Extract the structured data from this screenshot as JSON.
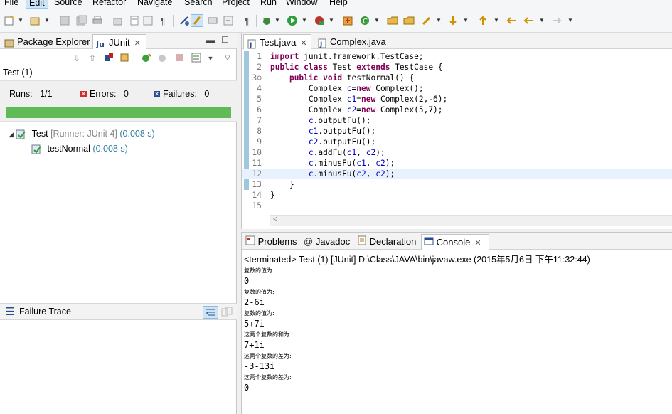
{
  "menu": [
    "File",
    "Edit",
    "Source",
    "Refactor",
    "Navigate",
    "Search",
    "Project",
    "Run",
    "Window",
    "Help"
  ],
  "left_tabs": {
    "package_explorer": "Package Explorer",
    "junit": "JUnit"
  },
  "junit": {
    "test_count_label": "Test (1)",
    "runs_label": "Runs:",
    "runs_value": "1/1",
    "errors_label": "Errors:",
    "errors_value": "0",
    "failures_label": "Failures:",
    "failures_value": "0",
    "progress_fraction": 1.0,
    "tree": {
      "root_name": "Test",
      "root_runner": "[Runner: JUnit 4]",
      "root_time": "(0.008 s)",
      "child_name": "testNormal",
      "child_time": "(0.008 s)"
    },
    "failure_trace_label": "Failure Trace"
  },
  "editor_tabs": [
    "Test.java",
    "Complex.java"
  ],
  "code_lines": [
    {
      "n": "1",
      "t": "import junit.framework.TestCase;"
    },
    {
      "n": "2",
      "t": "public class Test extends TestCase {"
    },
    {
      "n": "3⊖",
      "t": "    public void testNormal() {"
    },
    {
      "n": "4",
      "t": "        Complex c=new Complex();"
    },
    {
      "n": "5",
      "t": "        Complex c1=new Complex(2,-6);"
    },
    {
      "n": "6",
      "t": "        Complex c2=new Complex(5,7);"
    },
    {
      "n": "7",
      "t": "        c.outputFu();"
    },
    {
      "n": "8",
      "t": "        c1.outputFu();"
    },
    {
      "n": "9",
      "t": "        c2.outputFu();"
    },
    {
      "n": "10",
      "t": "        c.addFu(c1, c2);"
    },
    {
      "n": "11",
      "t": "        c.minusFu(c1, c2);"
    },
    {
      "n": "12",
      "t": "        c.minusFu(c2, c2);"
    },
    {
      "n": "13",
      "t": "    }"
    },
    {
      "n": "14",
      "t": "}"
    },
    {
      "n": "15",
      "t": ""
    }
  ],
  "bottom_tabs": [
    "Problems",
    "Javadoc",
    "Declaration",
    "Console"
  ],
  "console": {
    "title": "<terminated> Test (1) [JUnit] D:\\Class\\JAVA\\bin\\javaw.exe (2015年5月6日 下午11:32:44)",
    "lines": [
      {
        "t": "复数的值为:",
        "k": "small"
      },
      {
        "t": "0",
        "k": "big"
      },
      {
        "t": "复数的值为:",
        "k": "small"
      },
      {
        "t": "2-6i",
        "k": "big"
      },
      {
        "t": "复数的值为:",
        "k": "small"
      },
      {
        "t": "5+7i",
        "k": "big"
      },
      {
        "t": "这两个复数的和为:",
        "k": "small"
      },
      {
        "t": "7+1i",
        "k": "big"
      },
      {
        "t": "这两个复数的差为:",
        "k": "small"
      },
      {
        "t": "-3-13i",
        "k": "big"
      },
      {
        "t": "这两个复数的差为:",
        "k": "small"
      },
      {
        "t": "0",
        "k": "big"
      }
    ]
  },
  "colors": {
    "progress_green": "#5fba57",
    "keyword": "#7f0055",
    "variable": "#0000c0",
    "current_line": "#e8f2fe"
  }
}
